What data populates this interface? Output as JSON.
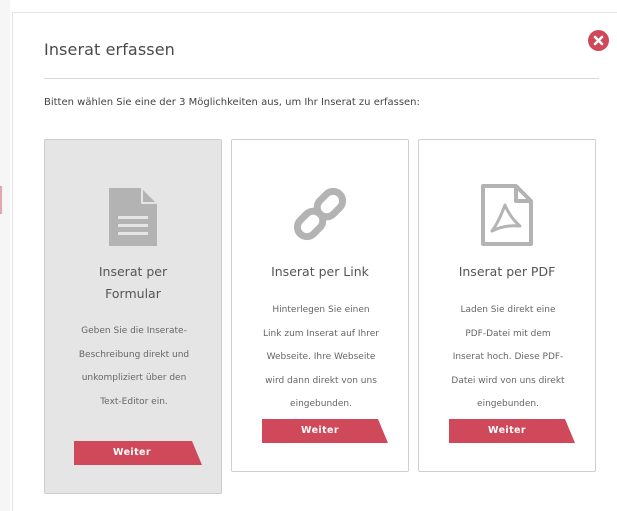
{
  "dialog": {
    "title": "Inserat erfassen",
    "intro": "Bitten wählen Sie eine der 3 Möglichkeiten aus, um Ihr Inserat zu erfassen:",
    "close_icon": "close-circle-icon"
  },
  "options": [
    {
      "icon": "document-icon",
      "heading_line1": "Inserat per",
      "heading_line2": "Formular",
      "desc": [
        "Geben Sie die Inserate-",
        "Beschreibung direkt und",
        "unkompliziert über den",
        "Text-Editor ein."
      ],
      "button": "Weiter",
      "selected": true
    },
    {
      "icon": "link-icon",
      "heading_line1": "Inserat per Link",
      "desc": [
        "Hinterlegen Sie einen",
        "Link zum Inserat auf Ihrer",
        "Webseite. Ihre Webseite",
        "wird dann direkt von uns",
        "eingebunden."
      ],
      "button": "Weiter",
      "selected": false
    },
    {
      "icon": "pdf-icon",
      "heading_line1": "Inserat per PDF",
      "desc": [
        "Laden Sie direkt eine",
        "PDF-Datei mit dem",
        "Inserat hoch. Diese PDF-",
        "Datei wird von uns direkt",
        "eingebunden."
      ],
      "button": "Weiter",
      "selected": false
    }
  ],
  "colors": {
    "accent": "#d0495a",
    "icon_gray": "#b3b3b3",
    "selected_bg": "#e5e5e5"
  }
}
